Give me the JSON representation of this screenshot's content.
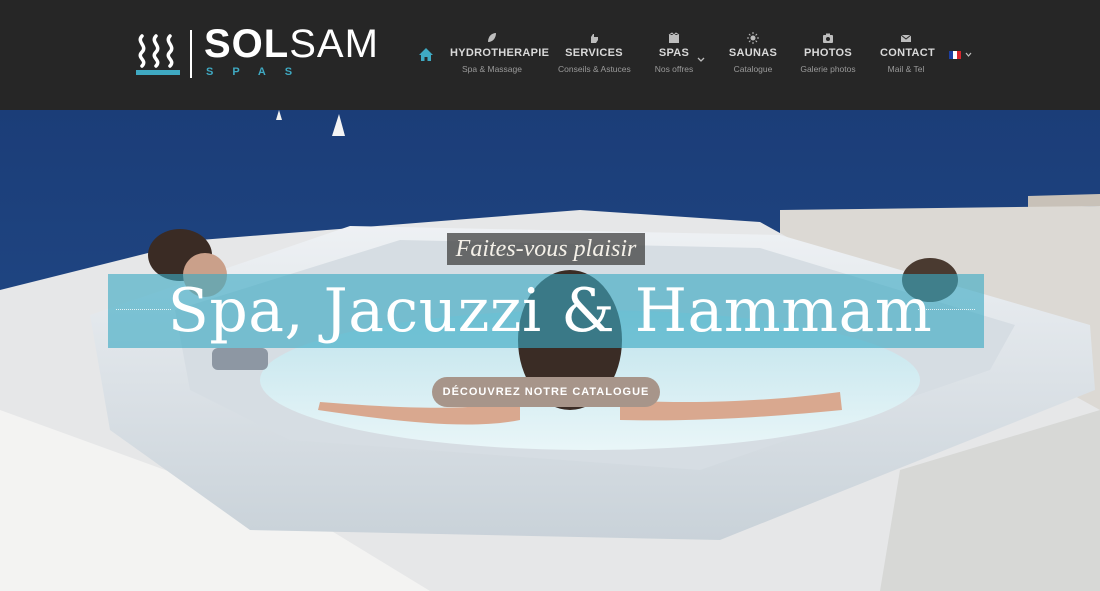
{
  "brand": {
    "name_bold": "SOL",
    "name_light": "SAM",
    "tagline": "SPAS",
    "accent": "#3fa9c2"
  },
  "nav": {
    "home_icon": "home-icon",
    "items": [
      {
        "label": "HYDROTHERAPIE",
        "sub": "Spa & Massage",
        "icon": "leaf-icon"
      },
      {
        "label": "SERVICES",
        "sub": "Conseils & Astuces",
        "icon": "hand-icon"
      },
      {
        "label": "SPAS",
        "sub": "Nos offres",
        "icon": "film-icon"
      },
      {
        "label": "SAUNAS",
        "sub": "Catalogue",
        "icon": "sun-icon"
      },
      {
        "label": "PHOTOS",
        "sub": "Galerie photos",
        "icon": "camera-icon"
      },
      {
        "label": "CONTACT",
        "sub": "Mail & Tel",
        "icon": "envelope-icon"
      }
    ],
    "language": "fr-flag-icon"
  },
  "hero": {
    "tagline": "Faites-vous plaisir",
    "headline": "Spa, Jacuzzi & Hammam",
    "cta": "DÉCOUVREZ NOTRE CATALOGUE",
    "band_color": "#3aaac3",
    "cta_color": "#a7958a"
  }
}
